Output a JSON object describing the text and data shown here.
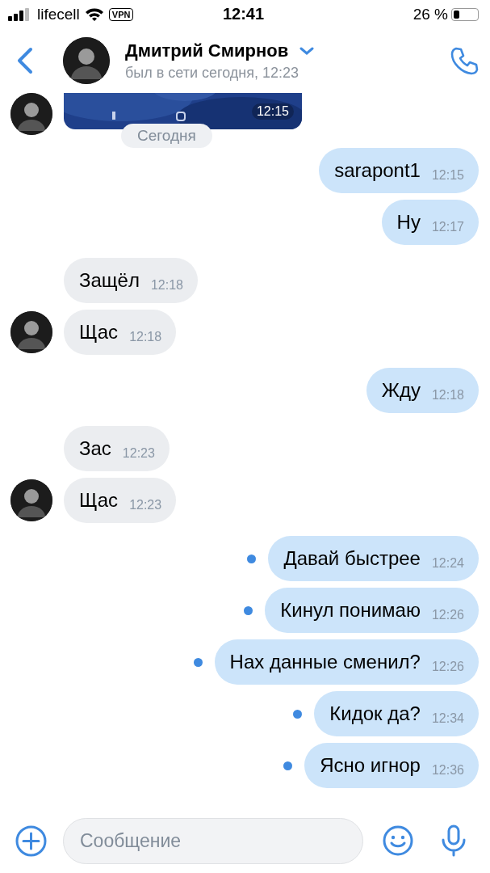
{
  "status_bar": {
    "carrier": "lifecell",
    "vpn": "VPN",
    "time": "12:41",
    "battery": "26 %"
  },
  "header": {
    "name": "Дмитрий Смирнов",
    "status": "был в сети сегодня, 12:23"
  },
  "date_pill": "Сегодня",
  "messages": [
    {
      "kind": "picture",
      "outgoing": false,
      "time": "12:15",
      "avatar": true,
      "unread": false
    },
    {
      "kind": "text",
      "outgoing": true,
      "text": "sarapont1",
      "time": "12:15",
      "avatar": false,
      "unread": false
    },
    {
      "kind": "text",
      "outgoing": true,
      "text": "Ну",
      "time": "12:17",
      "avatar": false,
      "unread": false
    },
    {
      "kind": "text",
      "outgoing": false,
      "text": "Защёл",
      "time": "12:18",
      "avatar": false,
      "unread": false
    },
    {
      "kind": "text",
      "outgoing": false,
      "text": "Щас",
      "time": "12:18",
      "avatar": true,
      "unread": false
    },
    {
      "kind": "text",
      "outgoing": true,
      "text": "Жду",
      "time": "12:18",
      "avatar": false,
      "unread": false
    },
    {
      "kind": "text",
      "outgoing": false,
      "text": "Зас",
      "time": "12:23",
      "avatar": false,
      "unread": false
    },
    {
      "kind": "text",
      "outgoing": false,
      "text": "Щас",
      "time": "12:23",
      "avatar": true,
      "unread": false
    },
    {
      "kind": "text",
      "outgoing": true,
      "text": "Давай быстрее",
      "time": "12:24",
      "avatar": false,
      "unread": true
    },
    {
      "kind": "text",
      "outgoing": true,
      "text": "Кинул понимаю",
      "time": "12:26",
      "avatar": false,
      "unread": true
    },
    {
      "kind": "text",
      "outgoing": true,
      "text": "Нах данные сменил?",
      "time": "12:26",
      "avatar": false,
      "unread": true
    },
    {
      "kind": "text",
      "outgoing": true,
      "text": "Кидок да?",
      "time": "12:34",
      "avatar": false,
      "unread": true
    },
    {
      "kind": "text",
      "outgoing": true,
      "text": "Ясно игнор",
      "time": "12:36",
      "avatar": false,
      "unread": true
    }
  ],
  "composer": {
    "placeholder": "Сообщение"
  }
}
